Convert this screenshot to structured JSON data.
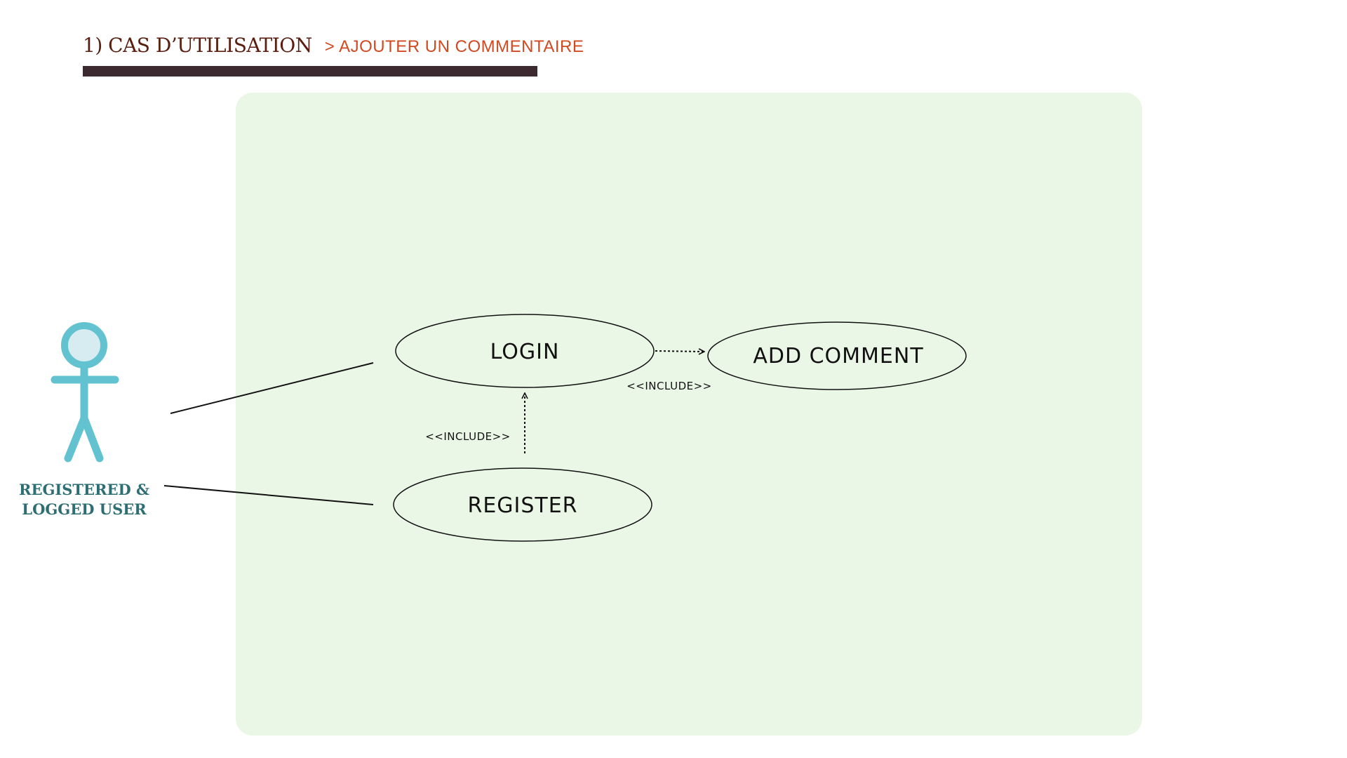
{
  "header": {
    "title": "1) CAS D’UTILISATION",
    "subtitle": "> AJOUTER UN COMMENTAIRE"
  },
  "actor": {
    "label_line1": "REGISTERED &",
    "label_line2": "LOGGED USER",
    "icon": "stick-figure-actor-icon"
  },
  "use_cases": {
    "login": "LOGIN",
    "add_comment": "ADD COMMENT",
    "register": "REGISTER"
  },
  "relations": {
    "login_to_add_comment": "<<INCLUDE>>",
    "register_to_login": "<<INCLUDE>>"
  },
  "colors": {
    "title": "#5a1e10",
    "subtitle": "#d04a22",
    "title_bar": "#3d2a30",
    "system_background": "#ebf7e6",
    "actor": "#62c2d0",
    "actor_head_fill": "#d6ecf0",
    "actor_label": "#2d6e73"
  }
}
